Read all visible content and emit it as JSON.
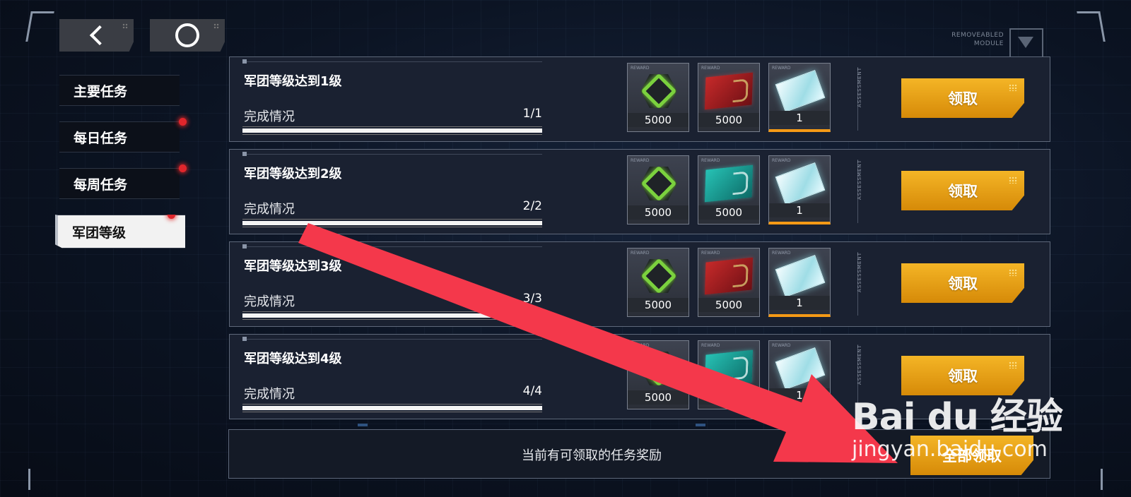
{
  "sidebar": {
    "items": [
      {
        "label": "主要任务",
        "has_alert": false,
        "active": false
      },
      {
        "label": "每日任务",
        "has_alert": true,
        "active": false
      },
      {
        "label": "每周任务",
        "has_alert": true,
        "active": false
      },
      {
        "label": "军团等级",
        "has_alert": true,
        "active": true
      }
    ]
  },
  "header": {
    "corner_label_line1": "REMOVEABLED",
    "corner_label_line2": "MODULE"
  },
  "tasks": [
    {
      "title": "军团等级达到1级",
      "progress_label": "完成情况",
      "progress_value": "1/1",
      "progress": 1.0,
      "rewards": [
        "5000",
        "5000",
        "1"
      ],
      "claim_label": "领取"
    },
    {
      "title": "军团等级达到2级",
      "progress_label": "完成情况",
      "progress_value": "2/2",
      "progress": 1.0,
      "rewards": [
        "5000",
        "5000",
        "1"
      ],
      "claim_label": "领取"
    },
    {
      "title": "军团等级达到3级",
      "progress_label": "完成情况",
      "progress_value": "3/3",
      "progress": 1.0,
      "rewards": [
        "5000",
        "5000",
        "1"
      ],
      "claim_label": "领取"
    },
    {
      "title": "军团等级达到4级",
      "progress_label": "完成情况",
      "progress_value": "4/4",
      "progress": 1.0,
      "rewards": [
        "5000",
        "5000",
        "1"
      ],
      "claim_label": "领取"
    }
  ],
  "assessment_label": "ASSESSMENT",
  "reward_tag": "REWARD",
  "bottom": {
    "message": "当前有可领取的任务奖励",
    "claim_all_label": "全部领取"
  },
  "watermark": {
    "brand": "Bai du 经验",
    "site": "jingyan.baidu.com"
  },
  "colors": {
    "accent_gold": "#e9a412",
    "alert_red": "#e0262c",
    "annotation_arrow": "#f4384b"
  },
  "icons": [
    "back-chevron-icon",
    "home-ring-icon",
    "triangle-icon",
    "gem-icon",
    "red-chip-icon",
    "teal-chip-icon",
    "card-icon"
  ]
}
